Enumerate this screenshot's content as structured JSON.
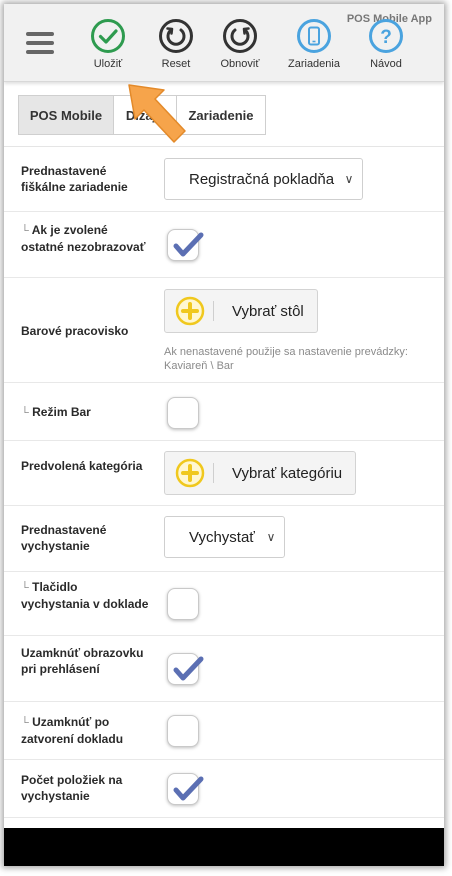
{
  "app_title": "POS Mobile App",
  "toolbar": {
    "save_label": "Uložiť",
    "reset_label": "Reset",
    "refresh_label": "Obnoviť",
    "devices_label": "Zariadenia",
    "help_label": "Návod",
    "help_glyph": "?"
  },
  "tabs": [
    {
      "label": "POS Mobile",
      "active": true
    },
    {
      "label": "Dizajn",
      "active": false
    },
    {
      "label": "Zariadenie",
      "active": false
    }
  ],
  "settings": {
    "fiscal_device": {
      "label": "Prednastavené fiškálne zariadenie",
      "value": "Registračná pokladňa"
    },
    "hide_others": {
      "tree": "└",
      "label": "Ak je zvolené ostatné nezobrazovať",
      "checked": true
    },
    "bar_station": {
      "label": "Barové pracovisko",
      "button": "Vybrať stôl",
      "hint": "Ak nenastavené použije sa nastavenie prevádzky: Kaviareň \\ Bar"
    },
    "bar_mode": {
      "tree": "└",
      "label": "Režim Bar",
      "checked": false
    },
    "default_category": {
      "label": "Predvolená kategória",
      "button": "Vybrať kategóriu"
    },
    "default_dispatch": {
      "label": "Prednastavené vychystanie",
      "value": "Vychystať"
    },
    "dispatch_button": {
      "tree": "└",
      "label": "Tlačidlo vychystania v doklade",
      "checked": false
    },
    "lock_on_login": {
      "label": "Uzamknúť obrazovku pri prehlásení",
      "checked": true
    },
    "lock_on_close": {
      "tree": "└",
      "label": "Uzamknúť po zatvorení dokladu",
      "checked": false
    },
    "items_count": {
      "label": "Počet položiek na vychystanie",
      "checked": true
    }
  },
  "colors": {
    "save_green": "#2e9b4f",
    "device_blue": "#4aa3df",
    "check_blue": "#5b6fb3",
    "plus_yellow": "#f0c81e",
    "arrow_orange": "#f6a44b"
  }
}
